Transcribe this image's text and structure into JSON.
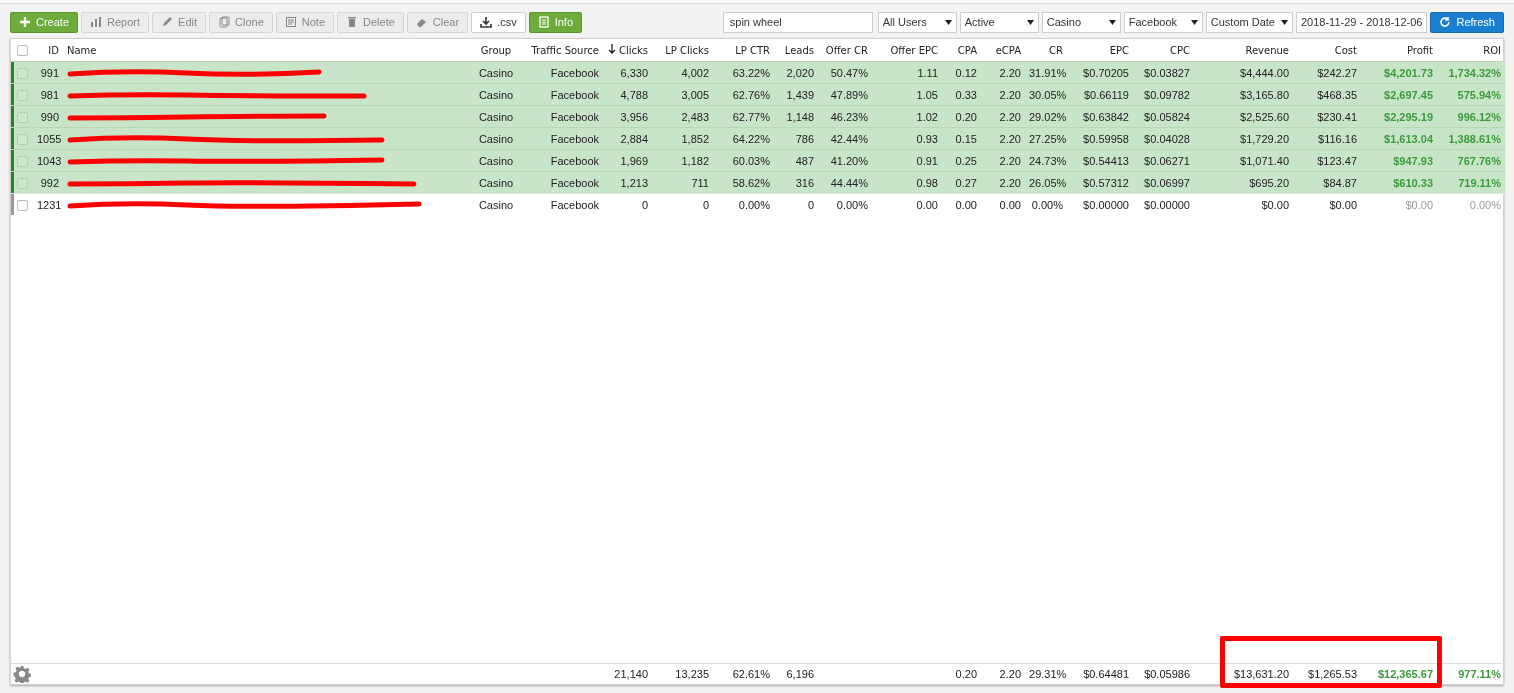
{
  "toolbar": {
    "buttons": [
      {
        "label": "Create",
        "kind": "primary",
        "disabled": false
      },
      {
        "label": "Report",
        "kind": "default",
        "disabled": true
      },
      {
        "label": "Edit",
        "kind": "default",
        "disabled": true
      },
      {
        "label": "Clone",
        "kind": "default",
        "disabled": true
      },
      {
        "label": "Note",
        "kind": "default",
        "disabled": true
      },
      {
        "label": "Delete",
        "kind": "default",
        "disabled": true
      },
      {
        "label": "Clear",
        "kind": "default",
        "disabled": true
      },
      {
        "label": ".csv",
        "kind": "default",
        "disabled": false
      },
      {
        "label": "Info",
        "kind": "primary",
        "disabled": false
      }
    ]
  },
  "filters": {
    "search": {
      "value": "spin wheel"
    },
    "selects": [
      "All Users",
      "Active",
      "Casino",
      "Facebook",
      "Custom Date"
    ],
    "date_range": "2018-11-29 - 2018-12-06",
    "refresh": "Refresh"
  },
  "table": {
    "select_all": {
      "checked": false
    },
    "columns": [
      {
        "label": "ID",
        "sorted": false
      },
      {
        "label": "Name",
        "sorted": false
      },
      {
        "label": "Group",
        "sorted": false
      },
      {
        "label": "Traffic Source",
        "sorted": false
      },
      {
        "label": "Clicks",
        "sorted": true
      },
      {
        "label": "LP Clicks",
        "sorted": false
      },
      {
        "label": "LP CTR",
        "sorted": false
      },
      {
        "label": "Leads",
        "sorted": false
      },
      {
        "label": "Offer CR",
        "sorted": false
      },
      {
        "label": "Offer EPC",
        "sorted": false
      },
      {
        "label": "CPA",
        "sorted": false
      },
      {
        "label": "eCPA",
        "sorted": false
      },
      {
        "label": "CR",
        "sorted": false
      },
      {
        "label": "EPC",
        "sorted": false
      },
      {
        "label": "CPC",
        "sorted": false
      },
      {
        "label": "Revenue",
        "sorted": false
      },
      {
        "label": "Cost",
        "sorted": false
      },
      {
        "label": "Profit",
        "sorted": false
      },
      {
        "label": "ROI",
        "sorted": false
      }
    ],
    "rows": [
      {
        "id": "991",
        "name_redacted": true,
        "highlighted": true,
        "checked": false,
        "group": "Casino",
        "source": "Facebook",
        "values": [
          "6,330",
          "4,002",
          "63.22%",
          "2,020",
          "50.47%",
          "1.11",
          "0.12",
          "2.20",
          "31.91%",
          "$0.70205",
          "$0.03827",
          "$4,444.00",
          "$242.27",
          "$4,201.73",
          "1,734.32%"
        ]
      },
      {
        "id": "981",
        "name_redacted": true,
        "highlighted": true,
        "checked": false,
        "group": "Casino",
        "source": "Facebook",
        "values": [
          "4,788",
          "3,005",
          "62.76%",
          "1,439",
          "47.89%",
          "1.05",
          "0.33",
          "2.20",
          "30.05%",
          "$0.66119",
          "$0.09782",
          "$3,165.80",
          "$468.35",
          "$2,697.45",
          "575.94%"
        ]
      },
      {
        "id": "990",
        "name_redacted": true,
        "highlighted": true,
        "checked": false,
        "group": "Casino",
        "source": "Facebook",
        "values": [
          "3,956",
          "2,483",
          "62.77%",
          "1,148",
          "46.23%",
          "1.02",
          "0.20",
          "2.20",
          "29.02%",
          "$0.63842",
          "$0.05824",
          "$2,525.60",
          "$230.41",
          "$2,295.19",
          "996.12%"
        ]
      },
      {
        "id": "1055",
        "name_redacted": true,
        "highlighted": true,
        "checked": false,
        "group": "Casino",
        "source": "Facebook",
        "values": [
          "2,884",
          "1,852",
          "64.22%",
          "786",
          "42.44%",
          "0.93",
          "0.15",
          "2.20",
          "27.25%",
          "$0.59958",
          "$0.04028",
          "$1,729.20",
          "$116.16",
          "$1,613.04",
          "1,388.61%"
        ]
      },
      {
        "id": "1043",
        "name_redacted": true,
        "highlighted": true,
        "checked": false,
        "group": "Casino",
        "source": "Facebook",
        "values": [
          "1,969",
          "1,182",
          "60.03%",
          "487",
          "41.20%",
          "0.91",
          "0.25",
          "2.20",
          "24.73%",
          "$0.54413",
          "$0.06271",
          "$1,071.40",
          "$123.47",
          "$947.93",
          "767.76%"
        ]
      },
      {
        "id": "992",
        "name_redacted": true,
        "highlighted": true,
        "checked": false,
        "group": "Casino",
        "source": "Facebook",
        "values": [
          "1,213",
          "711",
          "58.62%",
          "316",
          "44.44%",
          "0.98",
          "0.27",
          "2.20",
          "26.05%",
          "$0.57312",
          "$0.06997",
          "$695.20",
          "$84.87",
          "$610.33",
          "719.11%"
        ]
      },
      {
        "id": "1231",
        "name_redacted": true,
        "highlighted": false,
        "checked": false,
        "group": "Casino",
        "source": "Facebook",
        "values": [
          "0",
          "0",
          "0.00%",
          "0",
          "0.00%",
          "0.00",
          "0.00",
          "0.00",
          "0.00%",
          "$0.00000",
          "$0.00000",
          "$0.00",
          "$0.00",
          "$0.00",
          "0.00%"
        ]
      }
    ],
    "totals_volume": [
      "21,140",
      "13,235",
      "62.61%",
      "6,196"
    ],
    "totals_money": [
      "0.20",
      "2.20",
      "29.31%",
      "$0.64481",
      "$0.05986",
      "$13,631.20",
      "$1,265.53",
      "$12,365.67",
      "977.11%"
    ],
    "annotation_box": true
  }
}
